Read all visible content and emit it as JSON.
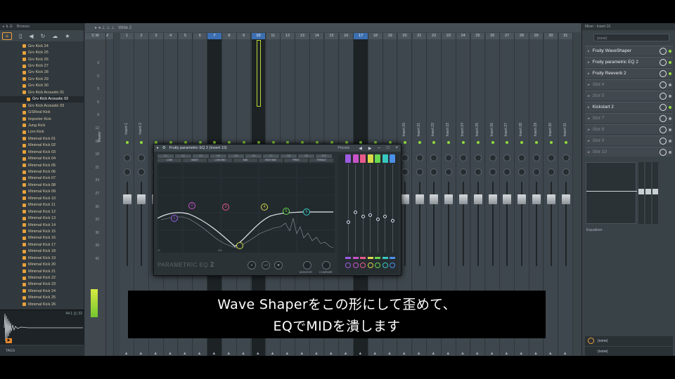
{
  "browser": {
    "title": "Browser",
    "items": [
      "Grv Kick 24",
      "Grv Kick 25",
      "Grv Kick 26",
      "Grv Kick 27",
      "Grv Kick 28",
      "Grv Kick 29",
      "Grv Kick 30",
      "Grv Kick Acoustic 01",
      "Grv Kick Acoustic 02",
      "Grv Kick Acoustic 03",
      "GSReal Kick",
      "Importer Kick",
      "Jung Kick",
      "Linn Kick",
      "Minimal Kick 01",
      "Minimal Kick 02",
      "Minimal Kick 03",
      "Minimal Kick 04",
      "Minimal Kick 05",
      "Minimal Kick 06",
      "Minimal Kick 07",
      "Minimal Kick 08",
      "Minimal Kick 09",
      "Minimal Kick 10",
      "Minimal Kick 11",
      "Minimal Kick 12",
      "Minimal Kick 13",
      "Minimal Kick 14",
      "Minimal Kick 15",
      "Minimal Kick 16",
      "Minimal Kick 17",
      "Minimal Kick 18",
      "Minimal Kick 19",
      "Minimal Kick 20",
      "Minimal Kick 21",
      "Minimal Kick 22",
      "Minimal Kick 23",
      "Minimal Kick 24",
      "Minimal Kick 25",
      "Minimal Kick 26"
    ],
    "selected_index": 8,
    "wave_info": "44.1 ▯▯ 32",
    "tags": "TAGS"
  },
  "mixer": {
    "view_label": "Wide 2",
    "master_label": "Master",
    "strip_numbers": [
      "C",
      "M",
      "1",
      "2",
      "3",
      "4",
      "5",
      "6",
      "7",
      "8",
      "9",
      "10",
      "11",
      "12",
      "13",
      "14",
      "15",
      "16",
      "17",
      "18",
      "19",
      "20",
      "21",
      "22",
      "23",
      "24",
      "25",
      "26",
      "27",
      "28",
      "29",
      "30",
      "31"
    ],
    "strip_labels": [
      "",
      "",
      "Insert 1",
      "Insert 2",
      "",
      "",
      "",
      "",
      "",
      "",
      "",
      "",
      "",
      "",
      "",
      "",
      "",
      "",
      "",
      "",
      "",
      "Insert 20",
      "Insert 21",
      "Insert 22",
      "Insert 23",
      "Insert 24",
      "Insert 25",
      "Insert 26",
      "Insert 27",
      "Insert 28",
      "Insert 29",
      "Insert 30",
      "Insert 31"
    ],
    "highlighted": [
      "7",
      "10",
      "17"
    ],
    "db_scale": [
      "3",
      "0",
      "3",
      "6",
      "9",
      "12",
      "15",
      "18",
      "21",
      "24",
      "27",
      "30",
      "33",
      "36",
      "39",
      "42"
    ]
  },
  "eq": {
    "title": "Fruity parametric EQ 2 (Insert 10)",
    "presets_label": "Presets",
    "tab_numbers": [
      "C1",
      "C2",
      "C3",
      "C4",
      "C5",
      "C6",
      "C7",
      "C8",
      "C9",
      "C10"
    ],
    "tab_labels": [
      "LOW",
      "BASS",
      "LOW MID",
      "MID",
      "HIGH MID",
      "PRES",
      "TREBLE"
    ],
    "brand": "PARAMETRIC EQ",
    "brand_num": "2",
    "monitor_label": "MONITOR",
    "compare_label": "COMPARE",
    "band_colors": [
      "#9b5ce0",
      "#c853c8",
      "#e85a8a",
      "#d8d84a",
      "#6ad850",
      "#38c8c0",
      "#4a90e8"
    ],
    "band_labels": [
      "1",
      "2",
      "3",
      "4",
      "5",
      "6",
      "7"
    ]
  },
  "inserts": {
    "title": "Mixer - Insert 10",
    "search_placeholder": "(none)",
    "slots": [
      {
        "label": "Fruity WaveShaper",
        "empty": false
      },
      {
        "label": "Fruity parametric EQ 2",
        "empty": false
      },
      {
        "label": "Fruity Reeverb 2",
        "empty": false
      },
      {
        "label": "Slot 4",
        "empty": true
      },
      {
        "label": "Slot 5",
        "empty": true
      },
      {
        "label": "Kickstart 2",
        "empty": false
      },
      {
        "label": "Slot 7",
        "empty": true
      },
      {
        "label": "Slot 8",
        "empty": true
      },
      {
        "label": "Slot 9",
        "empty": true
      },
      {
        "label": "Slot 10",
        "empty": true
      }
    ],
    "eq_label": "Equalizer",
    "out1": "(none)",
    "out2": "(none)"
  },
  "subtitle": {
    "line1": "Wave Shaperをこの形にして歪めて、",
    "line2": "EQでMIDを潰します"
  }
}
